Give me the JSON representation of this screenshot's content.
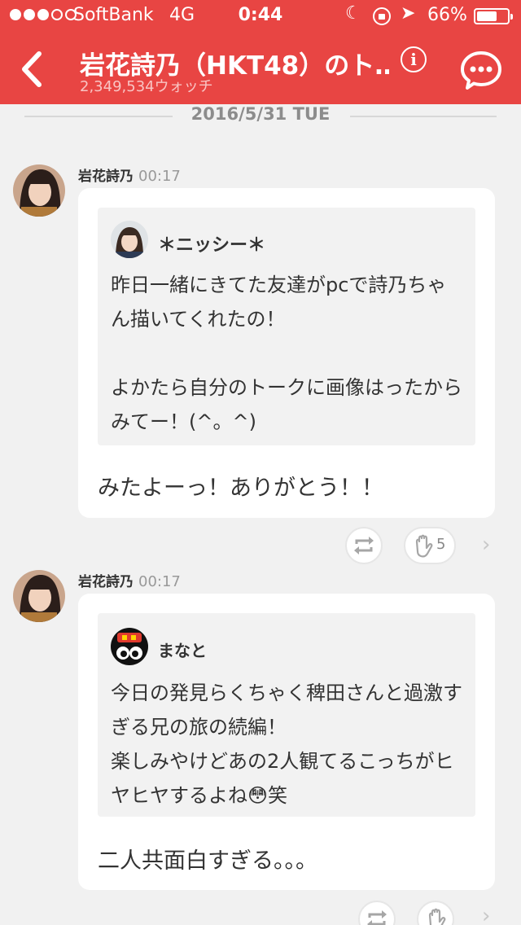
{
  "status_bar": {
    "carrier": "SoftBank",
    "network": "4G",
    "time": "0:44",
    "battery": "66%",
    "battery_level": 0.66
  },
  "header": {
    "title": "岩花詩乃（HKT48）のト…",
    "watch_count": "2,349,534ウォッチ",
    "info_label": "i"
  },
  "date_label": "2016/5/31 TUE",
  "messages": [
    {
      "sender": "岩花詩乃",
      "time": "00:17",
      "quoted_name": "＊ニッシー＊",
      "quoted_text": "昨日一緒にきてた友達がpcで詩乃ちゃん描いてくれたの！\n\nよかたら自分のトークに画像はったからみてー！(^。^)",
      "reply": "みたよーっ！ありがとう！！",
      "clap_count": "5"
    },
    {
      "sender": "岩花詩乃",
      "time": "00:17",
      "quoted_name": "まなと",
      "quoted_text": "今日の発見らくちゃく稗田さんと過激すぎる兄の旅の続編！\n楽しみやけどあの2人観てるこっちがヒヤヒヤするよね😳笑",
      "reply": "二人共面白すぎる。。。",
      "clap_count": ""
    }
  ],
  "colors": {
    "header_bg": "#e84543",
    "page_bg": "#f1f1f1"
  }
}
